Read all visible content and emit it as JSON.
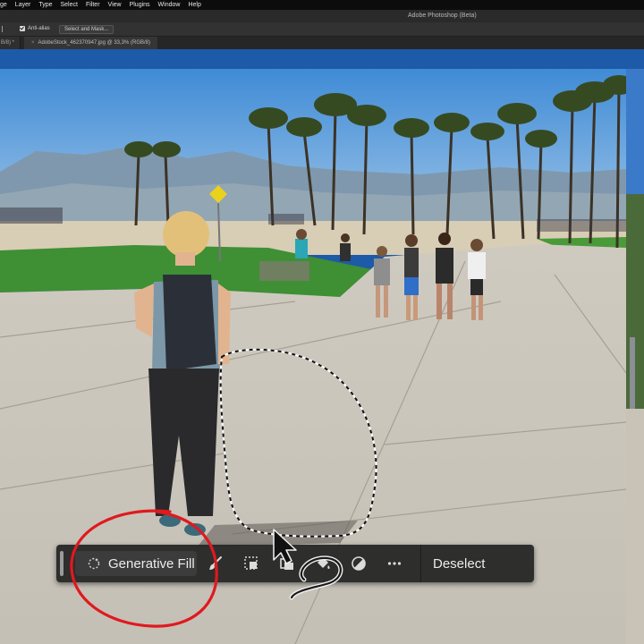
{
  "menubar": {
    "items": [
      "ge",
      "Layer",
      "Type",
      "Select",
      "Filter",
      "View",
      "Plugins",
      "Window",
      "Help"
    ]
  },
  "titlebar": {
    "title": "Adobe Photoshop (Beta)"
  },
  "optionsbar": {
    "antialias_label": "Anti-alias",
    "antialias_checked": true,
    "select_mask_label": "Select and Mask..."
  },
  "tabs": {
    "previous_tab_label": "B/8) *",
    "document_tab_label": "AdobeStock_462370947.jpg @ 33,3% (RGB/8)",
    "close_glyph": "×"
  },
  "taskbar": {
    "generative_fill_label": "Generative Fill",
    "tools": [
      {
        "icon": "brush-icon"
      },
      {
        "icon": "selection-mask-icon"
      },
      {
        "icon": "invert-selection-icon"
      },
      {
        "icon": "fill-bucket-icon"
      },
      {
        "icon": "adjustment-circle-icon"
      },
      {
        "icon": "more-options-icon"
      }
    ],
    "deselect_label": "Deselect"
  },
  "colors": {
    "canvas_background": "#1d5aa8",
    "taskbar_background": "#282828",
    "annotation_circle": "#e0191f"
  }
}
